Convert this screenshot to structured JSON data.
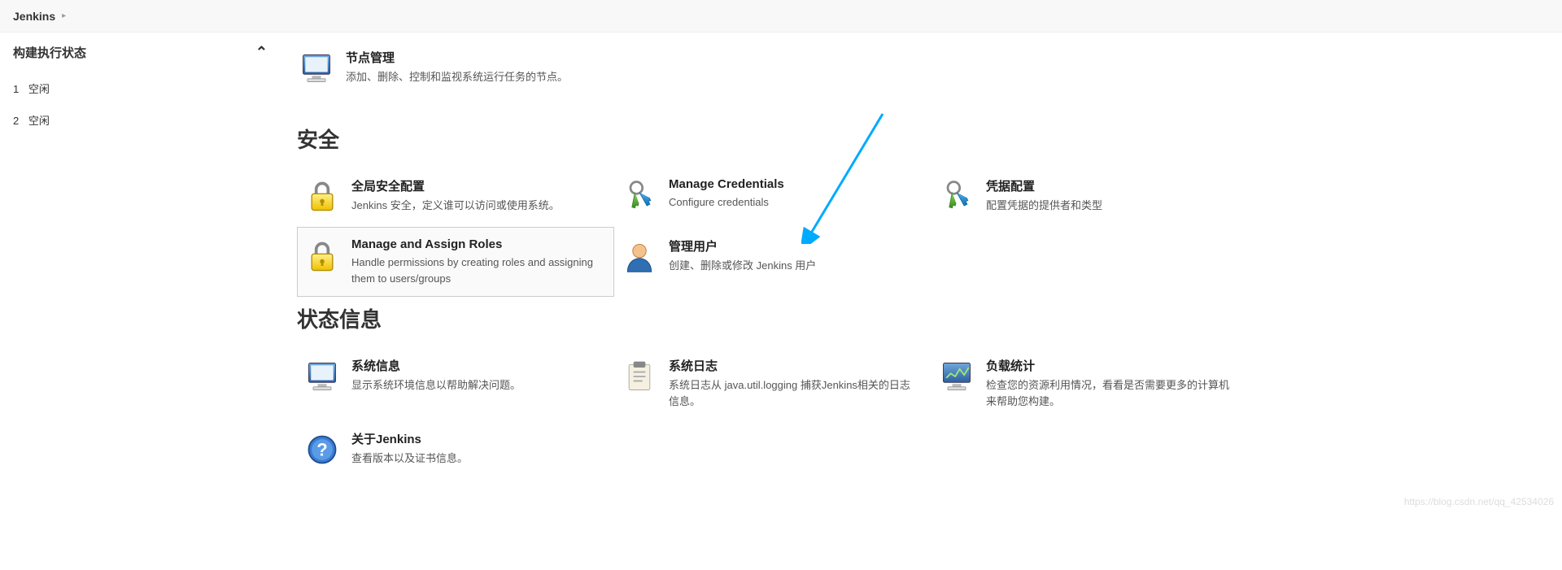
{
  "breadcrumb": {
    "jenkins": "Jenkins"
  },
  "sidebar": {
    "header": "构建执行状态",
    "executors": [
      {
        "num": "1",
        "status": "空闲"
      },
      {
        "num": "2",
        "status": "空闲"
      }
    ]
  },
  "topItem": {
    "title": "节点管理",
    "desc": "添加、删除、控制和监视系统运行任务的节点。"
  },
  "securitySection": {
    "title": "安全",
    "items": [
      {
        "title": "全局安全配置",
        "desc": "Jenkins 安全，定义谁可以访问或使用系统。"
      },
      {
        "title": "Manage Credentials",
        "desc": "Configure credentials"
      },
      {
        "title": "凭据配置",
        "desc": "配置凭据的提供者和类型"
      },
      {
        "title": "Manage and Assign Roles",
        "desc": "Handle permissions by creating roles and assigning them to users/groups"
      },
      {
        "title": "管理用户",
        "desc": "创建、删除或修改 Jenkins 用户"
      }
    ]
  },
  "statusSection": {
    "title": "状态信息",
    "items": [
      {
        "title": "系统信息",
        "desc": "显示系统环境信息以帮助解决问题。"
      },
      {
        "title": "系统日志",
        "desc": "系统日志从 java.util.logging 捕获Jenkins相关的日志信息。"
      },
      {
        "title": "负载统计",
        "desc": "检查您的资源利用情况，看看是否需要更多的计算机来帮助您构建。"
      },
      {
        "title": "关于Jenkins",
        "desc": "查看版本以及证书信息。"
      }
    ]
  },
  "watermark": "https://blog.csdn.net/qq_42534026"
}
